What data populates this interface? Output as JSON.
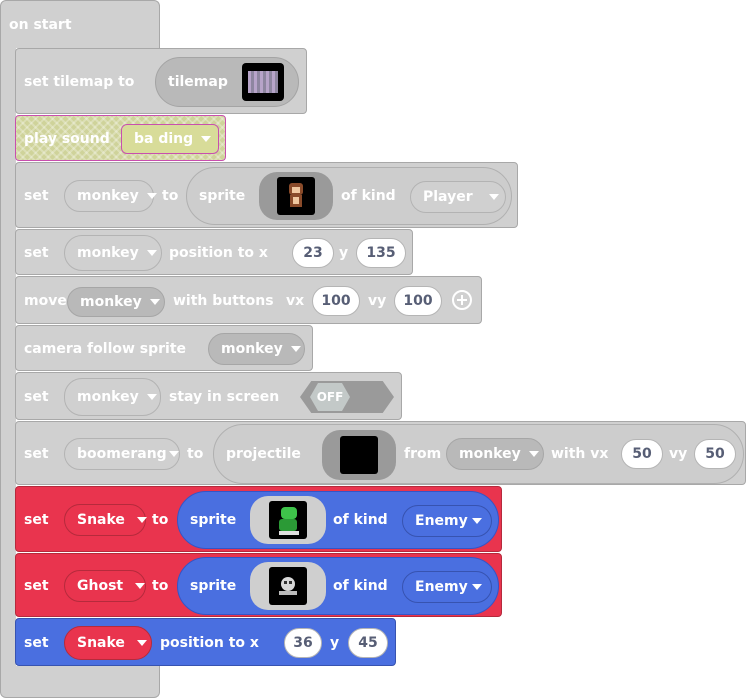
{
  "event": {
    "label": "on start"
  },
  "blocks": {
    "tilemap": {
      "set": "set tilemap to",
      "value": "tilemap"
    },
    "sound": {
      "label": "play sound",
      "value": "ba ding"
    },
    "create_monkey": {
      "set": "set",
      "var": "monkey",
      "to": "to",
      "sprite": "sprite",
      "of_kind": "of kind",
      "kind": "Player"
    },
    "position_monkey": {
      "set": "set",
      "var": "monkey",
      "label": "position to x",
      "x": "23",
      "y_label": "y",
      "y": "135"
    },
    "move_monkey": {
      "move": "move",
      "var": "monkey",
      "label": "with buttons",
      "vx_label": "vx",
      "vx": "100",
      "vy_label": "vy",
      "vy": "100"
    },
    "camera": {
      "label": "camera follow sprite",
      "var": "monkey"
    },
    "stay": {
      "set": "set",
      "var": "monkey",
      "label": "stay in screen",
      "toggle": "OFF"
    },
    "projectile": {
      "set": "set",
      "var": "boomerang",
      "to": "to",
      "label": "projectile",
      "from": "from",
      "source": "monkey",
      "vx_label": "with vx",
      "vx": "50",
      "vy_label": "vy",
      "vy": "50"
    },
    "snake": {
      "set": "set",
      "var": "Snake",
      "to": "to",
      "sprite": "sprite",
      "of_kind": "of kind",
      "kind": "Enemy"
    },
    "ghost": {
      "set": "set",
      "var": "Ghost",
      "to": "to",
      "sprite": "sprite",
      "of_kind": "of kind",
      "kind": "Enemy"
    },
    "snake_pos": {
      "set": "set",
      "var": "Snake",
      "label": "position to x",
      "x": "36",
      "y_label": "y",
      "y": "45"
    }
  },
  "colors": {
    "gray_block": "#d0d0d0",
    "sprites_pink": "#e9344e",
    "sprites_blue": "#4a6fe0",
    "disabled_hatch": "#cfd39a",
    "field_text": "#575e75"
  }
}
